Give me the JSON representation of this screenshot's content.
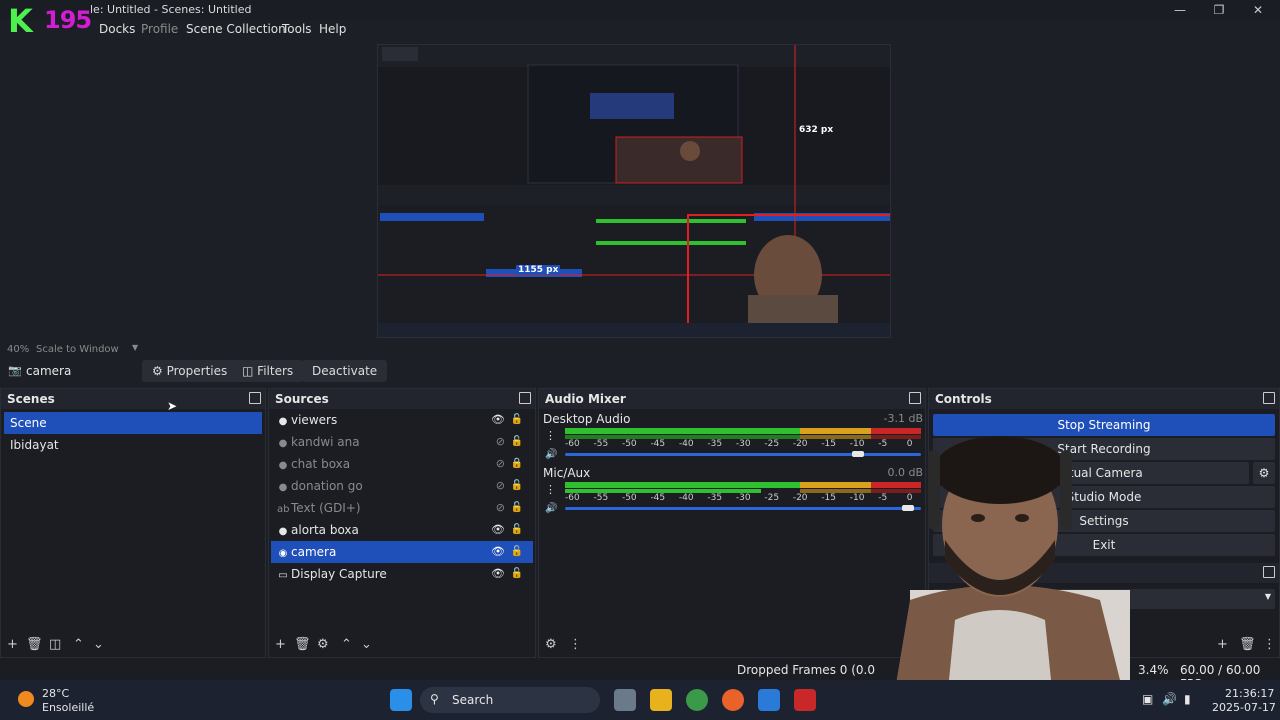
{
  "window": {
    "title": "le: Untitled - Scenes: Untitled",
    "logo_text": "195",
    "logo_letter": "K"
  },
  "menubar": {
    "items": [
      "Docks",
      "Profile",
      "Scene Collection",
      "Tools",
      "Help"
    ]
  },
  "preview": {
    "nested_label_height": "632 px",
    "nested_label_width": "1155 px"
  },
  "scale": {
    "zoom": "40%",
    "mode": "Scale to Window"
  },
  "source_toolbar": {
    "source_name": "camera",
    "properties_label": "Properties",
    "filters_label": "Filters",
    "deactivate_label": "Deactivate"
  },
  "scenes": {
    "title": "Scenes",
    "items": [
      {
        "label": "Scene",
        "selected": true
      },
      {
        "label": "Ibidayat",
        "selected": false
      }
    ]
  },
  "sources": {
    "title": "Sources",
    "items": [
      {
        "label": "viewers",
        "icon": "globe-icon",
        "visible": true,
        "locked": false
      },
      {
        "label": "kandwi ana",
        "icon": "globe-icon",
        "visible": false,
        "locked": false
      },
      {
        "label": "chat boxa",
        "icon": "globe-icon",
        "visible": false,
        "locked": true
      },
      {
        "label": "donation go",
        "icon": "globe-icon",
        "visible": false,
        "locked": false
      },
      {
        "label": "Text (GDI+)",
        "icon": "text-icon",
        "visible": false,
        "locked": false
      },
      {
        "label": "alorta boxa",
        "icon": "globe-icon",
        "visible": true,
        "locked": false
      },
      {
        "label": "camera",
        "icon": "camera-icon",
        "visible": true,
        "locked": false,
        "selected": true
      },
      {
        "label": "Display Capture",
        "icon": "monitor-icon",
        "visible": true,
        "locked": false
      }
    ]
  },
  "audio_mixer": {
    "title": "Audio Mixer",
    "scale_ticks": [
      "-60",
      "-55",
      "-50",
      "-45",
      "-40",
      "-35",
      "-30",
      "-25",
      "-20",
      "-15",
      "-10",
      "-5",
      "0"
    ],
    "channels": [
      {
        "name": "Desktop Audio",
        "db": "-3.1 dB",
        "volume": 0.84
      },
      {
        "name": "Mic/Aux",
        "db": "0.0 dB",
        "volume": 0.98
      }
    ]
  },
  "controls": {
    "title": "Controls",
    "buttons": [
      "Stop Streaming",
      "Start Recording",
      "rt Virtual Camera",
      "Studio Mode",
      "Settings",
      "Exit"
    ]
  },
  "status": {
    "dropped_frames": "Dropped Frames 0 (0.0",
    "cpu": "3.4%",
    "fps": "60.00 / 60.00 FPS"
  },
  "taskbar": {
    "temperature": "28°C",
    "weather": "Ensoleillé",
    "search_label": "Search",
    "time": "21:36:17",
    "date": "2025-07-17"
  },
  "colors": {
    "accent": "#1f4fb8",
    "meter_green": "#2fbf2f",
    "meter_yellow": "#d8a21e",
    "meter_red": "#c92727",
    "logo_green": "#4ef04e",
    "logo_magenta": "#d21ed2"
  }
}
